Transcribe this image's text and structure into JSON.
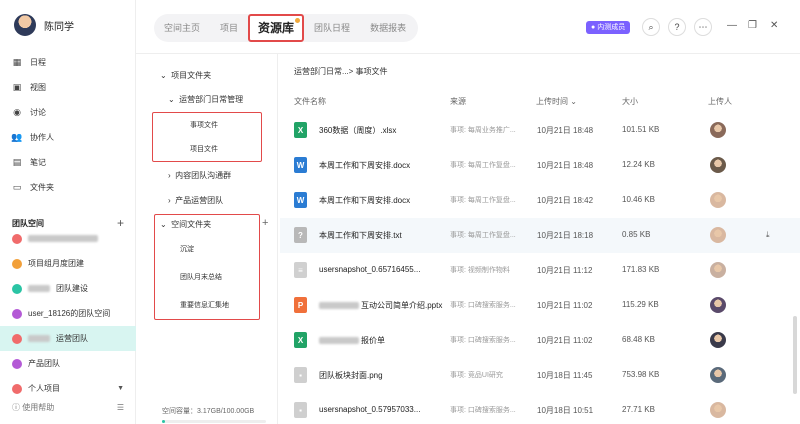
{
  "profile": {
    "name": "陈同学"
  },
  "nav": [
    {
      "icon": "calendar-icon",
      "glyph": "▦",
      "label": "日程"
    },
    {
      "icon": "view-icon",
      "glyph": "▣",
      "label": "视图"
    },
    {
      "icon": "discussion-icon",
      "glyph": "◉",
      "label": "讨论"
    },
    {
      "icon": "collaborator-icon",
      "glyph": "👥",
      "label": "协作人"
    },
    {
      "icon": "note-icon",
      "glyph": "▤",
      "label": "笔记"
    },
    {
      "icon": "folder-icon",
      "glyph": "▭",
      "label": "文件夹"
    }
  ],
  "team": {
    "header": "团队空间",
    "items": [
      {
        "label": "",
        "color": "#f06b6b",
        "blurred": true
      },
      {
        "label": "项目组月度团建",
        "color": "#f2a03a"
      },
      {
        "label": "团队建设",
        "color": "#2ac4a4",
        "blur_prefix": true
      },
      {
        "label": "user_18126的团队空间",
        "color": "#b45ad6"
      },
      {
        "label": "运营团队",
        "color": "#f06b6b",
        "blur_prefix": true,
        "active": true
      },
      {
        "label": "产品团队",
        "color": "#b45ad6"
      },
      {
        "label": "个人项目",
        "color": "#f06b6b",
        "dropdown": true
      }
    ]
  },
  "help": {
    "label": "使用帮助"
  },
  "tabs": [
    {
      "label": "空间主页"
    },
    {
      "label": "项目"
    },
    {
      "label": "资源库",
      "active": true
    },
    {
      "label": "团队日程"
    },
    {
      "label": "数据报表"
    }
  ],
  "badge": {
    "label": "内测成员"
  },
  "tree": {
    "project_folder": "项目文件夹",
    "ops_management": "运营部门日常管理",
    "matter_files": "事项文件",
    "project_files": "项目文件",
    "content_group": "内容团队沟通群",
    "product_ops": "产品运营团队",
    "space_folder": "空间文件夹",
    "precipitation": "沉淀",
    "monthly_summary": "团队月末总结",
    "important_info": "重要信息汇集地",
    "capacity": "空间容量：3.17GB/100.00GB",
    "capacity_used_fraction": 0.0317
  },
  "breadcrumb": "运营部门日常...> 事项文件",
  "columns": {
    "name": "文件名称",
    "source": "来源",
    "upload_time": "上传时间",
    "size": "大小",
    "uploader": "上传人"
  },
  "files": [
    {
      "type": "xlsx",
      "color": "#21a366",
      "glyph": "X",
      "name": "360数据（周度）.xlsx",
      "source": "事项: 每周业务推广...",
      "time": "10月21日 18:48",
      "size": "101.51 KB",
      "user_color": "#8a6a5a"
    },
    {
      "type": "docx",
      "color": "#2b7cd3",
      "glyph": "W",
      "name": "本周工作和下周安排.docx",
      "source": "事项: 每周工作复盘...",
      "time": "10月21日 18:48",
      "size": "12.24 KB",
      "user_color": "#6b5a4a"
    },
    {
      "type": "docx",
      "color": "#2b7cd3",
      "glyph": "W",
      "name": "本周工作和下周安排.docx",
      "source": "事项: 每周工作复盘...",
      "time": "10月21日 18:42",
      "size": "10.46 KB",
      "user_color": "#d9b8a0"
    },
    {
      "type": "txt",
      "color": "#b8b8b8",
      "glyph": "?",
      "name": "本周工作和下周安排.txt",
      "source": "事项: 每周工作复盘...",
      "time": "10月21日 18:18",
      "size": "0.85 KB",
      "user_color": "#d9b8a0",
      "highlight": true
    },
    {
      "type": "image",
      "color": "#d0d0d0",
      "glyph": "≡",
      "name": "usersnapshot_0.65716455...",
      "source": "事项: 视频制作物料",
      "time": "10月21日 11:12",
      "size": "171.83 KB",
      "user_color": "#c9b0a0"
    },
    {
      "type": "pptx",
      "color": "#f0703a",
      "glyph": "P",
      "name": "互动公司简单介绍.pptx",
      "source": "事项: 口碑搜索服务...",
      "time": "10月21日 11:02",
      "size": "115.29 KB",
      "user_color": "#5a4a6a",
      "blur_prefix": true
    },
    {
      "type": "xlsx",
      "color": "#21a366",
      "glyph": "X",
      "name": "报价单",
      "source": "事项: 口碑搜索服务...",
      "time": "10月21日 11:02",
      "size": "68.48 KB",
      "user_color": "#3a3a4a",
      "blur_prefix": true
    },
    {
      "type": "png",
      "color": "#cfcfcf",
      "glyph": "▪",
      "name": "团队板块封面.png",
      "source": "事项: 竞品UI研究",
      "time": "10月18日 11:45",
      "size": "753.98 KB",
      "user_color": "#5a6a7a"
    },
    {
      "type": "image",
      "color": "#cfcfcf",
      "glyph": "▪",
      "name": "usersnapshot_0.57957033...",
      "source": "事项: 口碑搜索服务...",
      "time": "10月18日 10:51",
      "size": "27.71 KB",
      "user_color": "#d9b8a0"
    }
  ]
}
